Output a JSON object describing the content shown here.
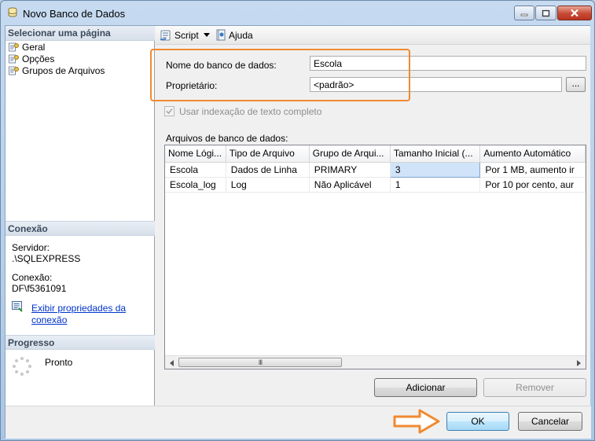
{
  "window": {
    "title": "Novo Banco de Dados",
    "icon": "database-icon"
  },
  "left": {
    "select_page_header": "Selecionar uma página",
    "pages": [
      {
        "label": "Geral",
        "icon": "page-icon"
      },
      {
        "label": "Opções",
        "icon": "page-icon"
      },
      {
        "label": "Grupos de Arquivos",
        "icon": "page-icon"
      }
    ],
    "connection_header": "Conexão",
    "server_label": "Servidor:",
    "server_value": ".\\SQLEXPRESS",
    "connection_label": "Conexão:",
    "connection_value": "DF\\f5361091",
    "view_props_link_line1": "Exibir propriedades da",
    "view_props_link_line2": "conexão",
    "progress_header": "Progresso",
    "progress_status": "Pronto"
  },
  "toolbar": {
    "script_label": "Script",
    "help_label": "Ajuda"
  },
  "form": {
    "db_name_label": "Nome do banco de dados:",
    "db_name_value": "Escola",
    "owner_label": "Proprietário:",
    "owner_value": "<padrão>",
    "browse_label": "...",
    "fulltext_label": "Usar indexação de texto completo",
    "fulltext_checked": true,
    "files_label": "Arquivos de banco de dados:"
  },
  "grid": {
    "columns": [
      "Nome Lógi...",
      "Tipo de Arquivo",
      "Grupo de Arqui...",
      "Tamanho Inicial (...",
      "Aumento Automático"
    ],
    "rows": [
      [
        "Escola",
        "Dados de Linha",
        "PRIMARY",
        "3",
        "Por 1 MB, aumento ir"
      ],
      [
        "Escola_log",
        "Log",
        "Não Aplicável",
        "1",
        "Por 10 por cento, aur"
      ]
    ],
    "scroll_thumb_glyph": "III"
  },
  "buttons": {
    "add_label": "Adicionar",
    "remove_label": "Remover",
    "ok_label": "OK",
    "cancel_label": "Cancelar"
  },
  "colors": {
    "highlight": "#f08a30",
    "link": "#0033cc",
    "selected_cell": "#d0e3f9"
  }
}
